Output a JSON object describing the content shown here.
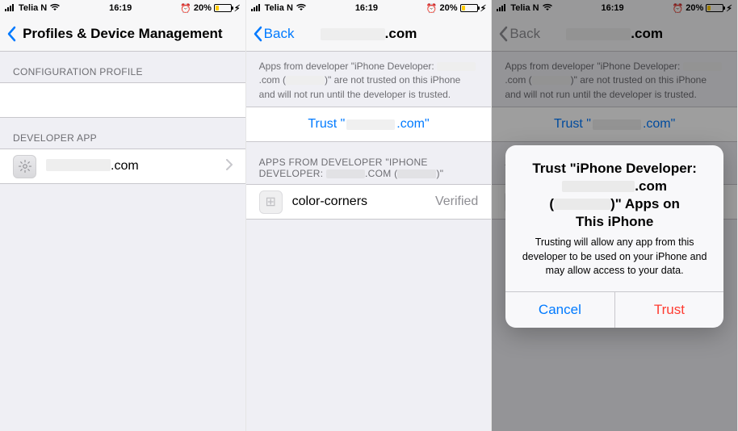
{
  "status": {
    "carrier": "Telia N",
    "time": "16:19",
    "battery_pct": "20%"
  },
  "screen1": {
    "title": "Profiles & Device Management",
    "section_config": "CONFIGURATION PROFILE",
    "section_devapp": "DEVELOPER APP",
    "devapp_suffix": ".com"
  },
  "screen2": {
    "back": "Back",
    "title_suffix": ".com",
    "not_trusted_pre": "Apps from developer \"iPhone Developer: ",
    "not_trusted_mid": ".com (",
    "not_trusted_post": ")\" are not trusted on this iPhone and will not run until the developer is trusted.",
    "trust_pre": "Trust \"",
    "trust_post": ".com\"",
    "apps_header_pre": "APPS FROM DEVELOPER \"IPHONE DEVELOPER:",
    "apps_header_mid": ".COM (",
    "apps_header_post": ")\"",
    "app_name": "color-corners",
    "app_status": "Verified"
  },
  "alert": {
    "title_l1": "Trust \"iPhone Developer:",
    "title_l2_suffix": ".com",
    "title_l3_pre": "(",
    "title_l3_post": ")\" Apps on",
    "title_l4": "This iPhone",
    "message": "Trusting will allow any app from this developer to be used on your iPhone and may allow access to your data.",
    "cancel": "Cancel",
    "trust": "Trust"
  }
}
